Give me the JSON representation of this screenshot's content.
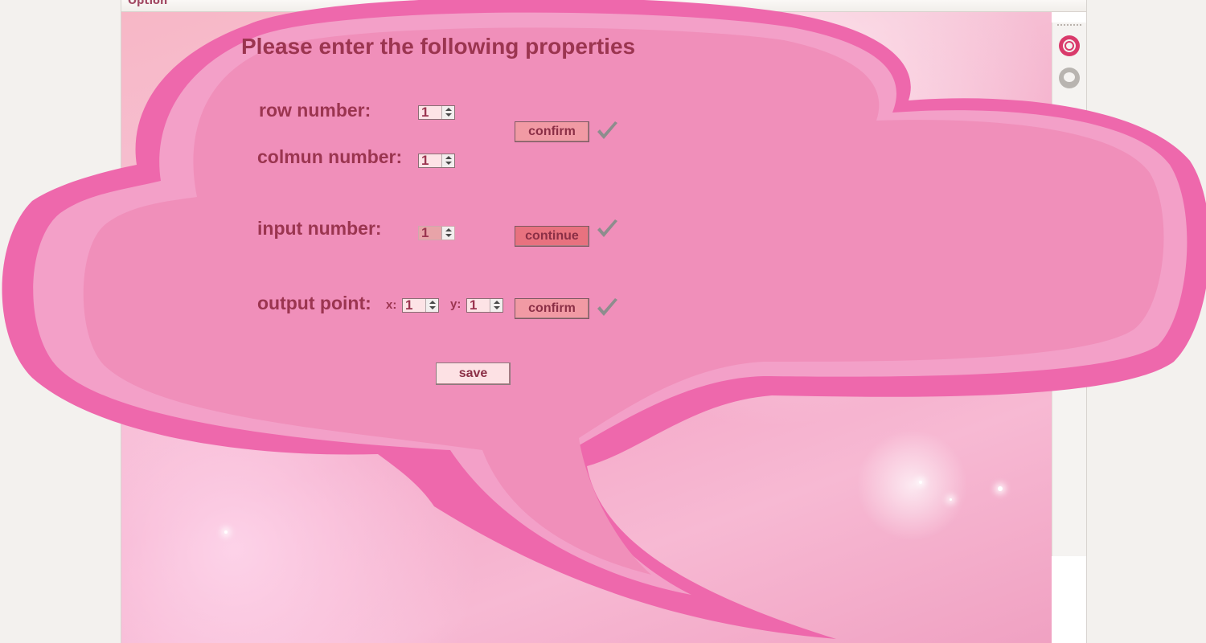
{
  "window": {
    "title": "Option"
  },
  "form": {
    "heading": "Please enter the following properties",
    "row_label": "row number:",
    "row_value": "1",
    "column_label": "colmun number:",
    "column_value": "1",
    "confirm_label": "confirm",
    "input_label": "input number:",
    "input_value": "1",
    "continue_label": "continue",
    "output_label": "output point:",
    "x_label": "x:",
    "x_value": "1",
    "y_label": "y:",
    "y_value": "1",
    "confirm2_label": "confirm",
    "save_label": "save"
  },
  "sidebar": {
    "icons": [
      "gear-icon",
      "chat-icon"
    ]
  },
  "colors": {
    "bubble_outer": "#ee68ac",
    "bubble_inner": "#f08fba",
    "text": "#9b3550",
    "accent": "#d93a6b"
  }
}
